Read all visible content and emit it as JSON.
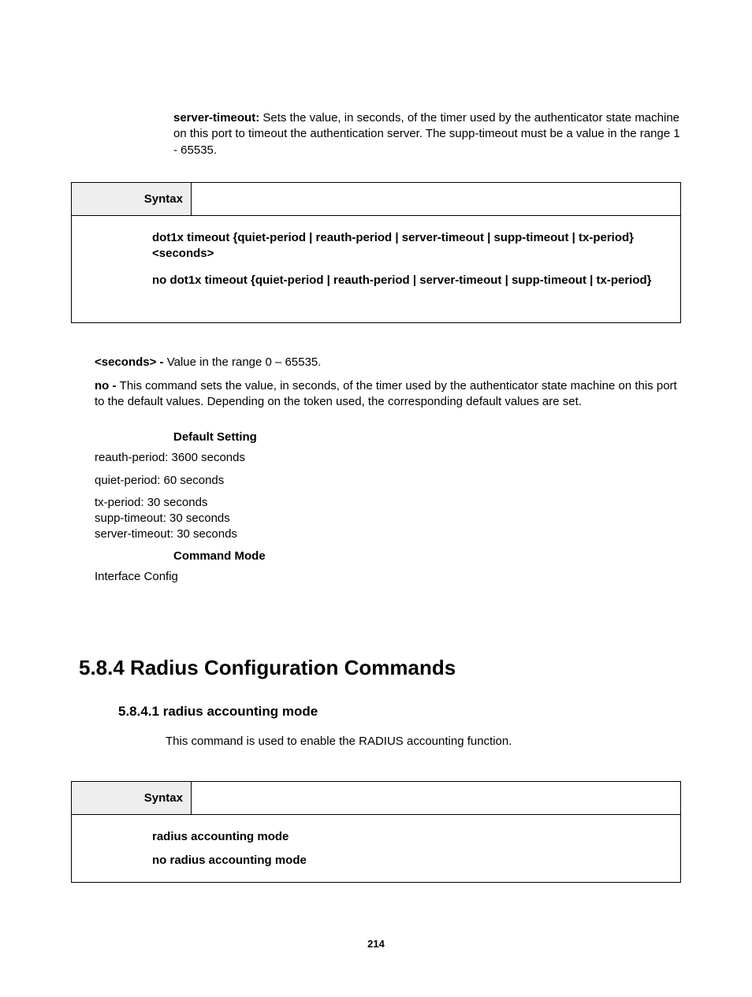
{
  "para_server_timeout": {
    "label": "server-timeout:",
    "text": " Sets the value, in seconds, of the timer used by the authenticator state machine on this port to timeout the authentication server. The supp-timeout must be a value in the range 1 - 65535."
  },
  "syntax1": {
    "header": "Syntax",
    "line1": "dot1x timeout {quiet-period | reauth-period | server-timeout | supp-timeout | tx-period} <seconds>",
    "line2": "no dot1x timeout {quiet-period | reauth-period | server-timeout | supp-timeout | tx-period}"
  },
  "seconds": {
    "label": "<seconds> - ",
    "text": "Value in the range 0 – 65535."
  },
  "no": {
    "label": "no - ",
    "text": "This command sets the value, in seconds, of the timer used by the authenticator state machine on this port to the default values. Depending on the token used, the corresponding default values are set."
  },
  "default_setting": {
    "heading": "Default Setting",
    "reauth": "reauth-period: 3600 seconds",
    "quiet": "quiet-period: 60 seconds",
    "tx": "tx-period: 30 seconds",
    "supp": "supp-timeout: 30 seconds",
    "server": "server-timeout: 30 seconds"
  },
  "command_mode": {
    "heading": "Command Mode",
    "value": "Interface Config"
  },
  "section": {
    "number": "5.8.4",
    "title": " Radius Configuration Commands"
  },
  "subsection": {
    "number": "5.8.4.1",
    "title": " radius accounting mode",
    "body": "This command is used to enable the RADIUS accounting function."
  },
  "syntax2": {
    "header": "Syntax",
    "line1": "radius accounting mode",
    "line2": "no radius accounting mode"
  },
  "page_number": "214"
}
